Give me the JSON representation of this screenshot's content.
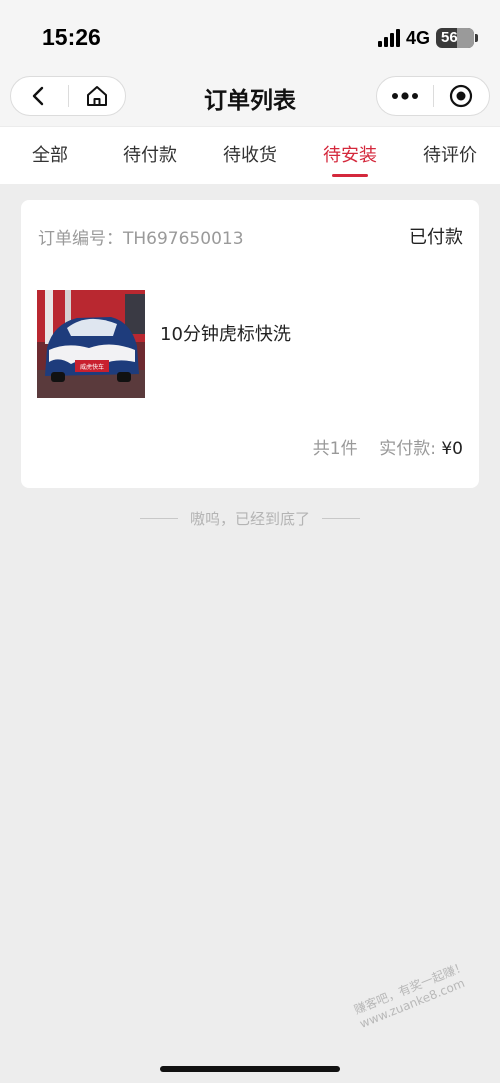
{
  "status_bar": {
    "time": "15:26",
    "network": "4G",
    "battery": "56",
    "battery_level": 0.56
  },
  "nav": {
    "title": "订单列表",
    "back_icon": "chevron-left-icon",
    "home_icon": "home-icon",
    "more_icon": "more-dots-icon",
    "target_icon": "target-circle-icon"
  },
  "tabs": [
    {
      "label": "全部",
      "active": false
    },
    {
      "label": "待付款",
      "active": false
    },
    {
      "label": "待收货",
      "active": false
    },
    {
      "label": "待安装",
      "active": true
    },
    {
      "label": "待评价",
      "active": false
    }
  ],
  "order": {
    "order_no_label": "订单编号：",
    "order_no": "TH697650013",
    "status": "已付款",
    "product_name": "10分钟虎标快洗",
    "image_caption": "威虎快车",
    "count_text": "共1件",
    "paid_label": "实付款:",
    "paid_amount": "¥0"
  },
  "end_tip": "嗷呜，已经到底了",
  "watermark": {
    "line1": "赚客吧，有奖一起赚！",
    "line2": "www.zuanke8.com"
  },
  "colors": {
    "accent": "#d4283c",
    "background": "#ededed",
    "card": "#ffffff"
  }
}
